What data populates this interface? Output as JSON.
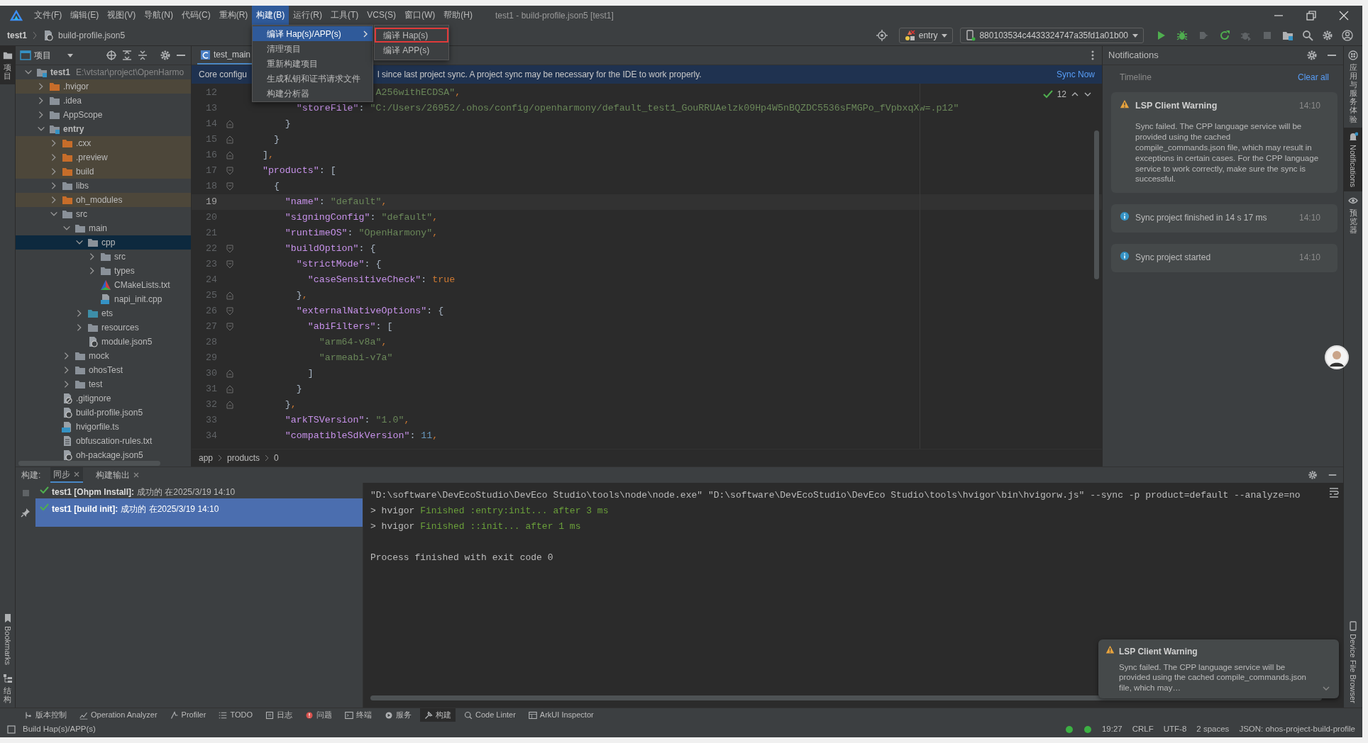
{
  "menubar": {
    "items": [
      {
        "label": "文件(F)",
        "selected": false
      },
      {
        "label": "编辑(E)",
        "selected": false
      },
      {
        "label": "视图(V)",
        "selected": false
      },
      {
        "label": "导航(N)",
        "selected": false
      },
      {
        "label": "代码(C)",
        "selected": false
      },
      {
        "label": "重构(R)",
        "selected": false
      },
      {
        "label": "构建(B)",
        "selected": true
      },
      {
        "label": "运行(R)",
        "selected": false
      },
      {
        "label": "工具(T)",
        "selected": false
      },
      {
        "label": "VCS(S)",
        "selected": false
      },
      {
        "label": "窗口(W)",
        "selected": false
      },
      {
        "label": "帮助(H)",
        "selected": false
      }
    ],
    "title": "test1 - build-profile.json5 [test1]"
  },
  "build_menu": {
    "items": [
      {
        "label": "编译 Hap(s)/APP(s)",
        "selected": true,
        "submenu": true
      },
      {
        "label": "清理项目",
        "selected": false,
        "submenu": false
      },
      {
        "label": "重新构建项目",
        "selected": false,
        "submenu": false
      },
      {
        "label": "生成私钥和证书请求文件",
        "selected": false,
        "submenu": false
      },
      {
        "label": "构建分析器",
        "selected": false,
        "submenu": false
      }
    ]
  },
  "submenu": {
    "items": [
      {
        "label": "编译 Hap(s)",
        "outlined": true
      },
      {
        "label": "编译 APP(s)",
        "outlined": false
      }
    ]
  },
  "navbar": {
    "project": "test1",
    "file": "build-profile.json5",
    "module": "entry",
    "device": "880103534c4433324747a35fd1a01b00"
  },
  "toolbar_buttons": [
    {
      "kind": "run",
      "disabled": false
    },
    {
      "kind": "debug",
      "disabled": false
    },
    {
      "kind": "profile",
      "disabled": true
    },
    {
      "kind": "restart",
      "disabled": false
    },
    {
      "kind": "attach",
      "disabled": true
    },
    {
      "kind": "stop",
      "disabled": true
    }
  ],
  "left_strip": {
    "top": [
      {
        "label": "项目",
        "selected": true
      }
    ],
    "bottom": [
      {
        "label": "Bookmarks",
        "kind": "latin"
      },
      {
        "label": "结构",
        "kind": "cjk"
      }
    ]
  },
  "project_panel": {
    "title": "项目",
    "tree": [
      {
        "name": "test1",
        "kind": "module",
        "path": "E:\\vtstar\\project\\OpenHarmo",
        "expanded": true,
        "selected": false,
        "children": [
          {
            "name": ".hvigor",
            "kind": "excluded",
            "expanded": false,
            "selected": false
          },
          {
            "name": ".idea",
            "kind": "folder",
            "expanded": false,
            "selected": false
          },
          {
            "name": "AppScope",
            "kind": "folder",
            "expanded": false,
            "selected": false
          },
          {
            "name": "entry",
            "kind": "module",
            "expanded": true,
            "selected": false,
            "children": [
              {
                "name": ".cxx",
                "kind": "excluded",
                "expanded": false,
                "selected": false
              },
              {
                "name": ".preview",
                "kind": "excluded",
                "expanded": false,
                "selected": false
              },
              {
                "name": "build",
                "kind": "excluded",
                "expanded": false,
                "selected": false
              },
              {
                "name": "libs",
                "kind": "folder",
                "expanded": false,
                "selected": false
              },
              {
                "name": "oh_modules",
                "kind": "excluded",
                "expanded": false,
                "selected": false
              },
              {
                "name": "src",
                "kind": "folder",
                "expanded": true,
                "selected": false,
                "children": [
                  {
                    "name": "main",
                    "kind": "folder",
                    "expanded": true,
                    "selected": false,
                    "children": [
                      {
                        "name": "cpp",
                        "kind": "folder",
                        "expanded": true,
                        "selected": true,
                        "children": [
                          {
                            "name": "src",
                            "kind": "folder",
                            "expanded": false,
                            "selected": false
                          },
                          {
                            "name": "types",
                            "kind": "folder",
                            "expanded": false,
                            "selected": false
                          },
                          {
                            "name": "CMakeLists.txt",
                            "kind": "cmake",
                            "selected": false
                          },
                          {
                            "name": "napi_init.cpp",
                            "kind": "cpp",
                            "selected": false
                          }
                        ]
                      },
                      {
                        "name": "ets",
                        "kind": "source",
                        "expanded": false,
                        "selected": false
                      },
                      {
                        "name": "resources",
                        "kind": "folder",
                        "expanded": false,
                        "selected": false
                      },
                      {
                        "name": "module.json5",
                        "kind": "json5",
                        "selected": false
                      }
                    ]
                  },
                  {
                    "name": "mock",
                    "kind": "folder",
                    "expanded": false,
                    "selected": false
                  },
                  {
                    "name": "ohosTest",
                    "kind": "folder",
                    "expanded": false,
                    "selected": false
                  },
                  {
                    "name": "test",
                    "kind": "folder",
                    "expanded": false,
                    "selected": false
                  }
                ]
              },
              {
                "name": ".gitignore",
                "kind": "gitignore",
                "selected": false
              },
              {
                "name": "build-profile.json5",
                "kind": "json5",
                "selected": false
              },
              {
                "name": "hvigorfile.ts",
                "kind": "ts",
                "selected": false
              },
              {
                "name": "obfuscation-rules.txt",
                "kind": "text",
                "selected": false
              },
              {
                "name": "oh-package.json5",
                "kind": "json5",
                "selected": false
              }
            ]
          }
        ]
      }
    ]
  },
  "editor": {
    "tab": "test_main",
    "banner": {
      "text_start": "Core configu",
      "text_end": "l since last project sync. A project sync may be necessary for the IDE to work properly.",
      "action": "Sync Now"
    },
    "inspections": "12",
    "lines": [
      {
        "number": "12",
        "current": false,
        "partial": true,
        "tokens": [
          {
            "kind": "str",
            "s": "A256withECDSA\""
          },
          {
            "kind": "c",
            "s": ","
          }
        ]
      },
      {
        "number": "13",
        "current": false,
        "tokens": [
          {
            "kind": "key",
            "s": "\"storeFile\""
          },
          {
            "kind": "p",
            "s": ": "
          },
          {
            "kind": "str",
            "s": "\"C:/Users/26952/.ohos/config/openharmony/default_test1_GouRRUAelzk09Hp4W5nBQZDC5536sFMGPo_fVpbxqXw=.p12\""
          }
        ]
      },
      {
        "number": "14",
        "current": false,
        "fold_end": true,
        "tokens": [
          {
            "kind": "p",
            "s": "}"
          }
        ]
      },
      {
        "number": "15",
        "current": false,
        "fold_end": true,
        "tokens": [
          {
            "kind": "p",
            "s": "}"
          }
        ]
      },
      {
        "number": "16",
        "current": false,
        "fold_end": true,
        "tokens": [
          {
            "kind": "p",
            "s": "]"
          },
          {
            "kind": "c",
            "s": ","
          }
        ]
      },
      {
        "number": "17",
        "current": false,
        "fold_start": true,
        "tokens": [
          {
            "kind": "key",
            "s": "\"products\""
          },
          {
            "kind": "p",
            "s": ": ["
          }
        ]
      },
      {
        "number": "18",
        "current": false,
        "fold_start": true,
        "tokens": [
          {
            "kind": "p",
            "s": "{"
          }
        ]
      },
      {
        "number": "19",
        "current": true,
        "tokens": [
          {
            "kind": "key",
            "s": "\"name\""
          },
          {
            "kind": "p",
            "s": ": "
          },
          {
            "kind": "str",
            "s": "\"default\""
          },
          {
            "kind": "c",
            "s": ","
          }
        ]
      },
      {
        "number": "20",
        "current": false,
        "tokens": [
          {
            "kind": "key",
            "s": "\"signingConfig\""
          },
          {
            "kind": "p",
            "s": ": "
          },
          {
            "kind": "str",
            "s": "\"default\""
          },
          {
            "kind": "c",
            "s": ","
          }
        ]
      },
      {
        "number": "21",
        "current": false,
        "tokens": [
          {
            "kind": "key",
            "s": "\"runtimeOS\""
          },
          {
            "kind": "p",
            "s": ": "
          },
          {
            "kind": "str",
            "s": "\"OpenHarmony\""
          },
          {
            "kind": "c",
            "s": ","
          }
        ]
      },
      {
        "number": "22",
        "current": false,
        "fold_start": true,
        "tokens": [
          {
            "kind": "key",
            "s": "\"buildOption\""
          },
          {
            "kind": "p",
            "s": ": {"
          }
        ]
      },
      {
        "number": "23",
        "current": false,
        "fold_start": true,
        "tokens": [
          {
            "kind": "key",
            "s": "\"strictMode\""
          },
          {
            "kind": "p",
            "s": ": {"
          }
        ]
      },
      {
        "number": "24",
        "current": false,
        "tokens": [
          {
            "kind": "key",
            "s": "\"caseSensitiveCheck\""
          },
          {
            "kind": "p",
            "s": ": "
          },
          {
            "kind": "bool",
            "s": "true"
          }
        ]
      },
      {
        "number": "25",
        "current": false,
        "fold_end": true,
        "tokens": [
          {
            "kind": "p",
            "s": "}"
          },
          {
            "kind": "c",
            "s": ","
          }
        ]
      },
      {
        "number": "26",
        "current": false,
        "fold_start": true,
        "tokens": [
          {
            "kind": "key",
            "s": "\"externalNativeOptions\""
          },
          {
            "kind": "p",
            "s": ": {"
          }
        ]
      },
      {
        "number": "27",
        "current": false,
        "fold_start": true,
        "tokens": [
          {
            "kind": "key",
            "s": "\"abiFilters\""
          },
          {
            "kind": "p",
            "s": ": ["
          }
        ]
      },
      {
        "number": "28",
        "current": false,
        "tokens": [
          {
            "kind": "str",
            "s": "\"arm64-v8a\""
          },
          {
            "kind": "c",
            "s": ","
          }
        ]
      },
      {
        "number": "29",
        "current": false,
        "tokens": [
          {
            "kind": "str",
            "s": "\"armeabi-v7a\""
          }
        ]
      },
      {
        "number": "30",
        "current": false,
        "fold_end": true,
        "tokens": [
          {
            "kind": "p",
            "s": "]"
          }
        ]
      },
      {
        "number": "31",
        "current": false,
        "fold_end": true,
        "tokens": [
          {
            "kind": "p",
            "s": "}"
          }
        ]
      },
      {
        "number": "32",
        "current": false,
        "fold_end": true,
        "tokens": [
          {
            "kind": "p",
            "s": "}"
          },
          {
            "kind": "c",
            "s": ","
          }
        ]
      },
      {
        "number": "33",
        "current": false,
        "tokens": [
          {
            "kind": "key",
            "s": "\"arkTSVersion\""
          },
          {
            "kind": "p",
            "s": ": "
          },
          {
            "kind": "str",
            "s": "\"1.0\""
          },
          {
            "kind": "c",
            "s": ","
          }
        ]
      },
      {
        "number": "34",
        "current": false,
        "tokens": [
          {
            "kind": "key",
            "s": "\"compatibleSdkVersion\""
          },
          {
            "kind": "p",
            "s": ": "
          },
          {
            "kind": "num",
            "s": "11"
          },
          {
            "kind": "c",
            "s": ","
          }
        ]
      }
    ],
    "breadcrumb": [
      "app",
      "products",
      "0"
    ]
  },
  "notifications": {
    "title": "Notifications",
    "timeline": "Timeline",
    "clear": "Clear all",
    "items": [
      {
        "kind": "warning",
        "title": "LSP Client Warning",
        "body": "Sync failed. The CPP language service will be provided using the cached compile_commands.json file, which may result in exceptions in certain cases. For the CPP language service to work correctly, make sure the sync is successful.",
        "time": "14:10"
      },
      {
        "kind": "info",
        "title": "Sync project finished in 14 s 17 ms",
        "time": "14:10"
      },
      {
        "kind": "info",
        "title": "Sync project started",
        "time": "14:10"
      }
    ]
  },
  "right_strip": {
    "top": [
      {
        "label": "应用与服务体验",
        "kind": "cjk",
        "selected": false
      },
      {
        "label": "Notifications",
        "kind": "latin",
        "selected": true
      },
      {
        "label": "预览器",
        "kind": "cjk",
        "selected": false
      }
    ],
    "bottom": [
      {
        "label": "Device File Browser",
        "kind": "latin"
      }
    ]
  },
  "build_panel": {
    "label": "构建:",
    "tabs": [
      {
        "label": "同步",
        "selected": true
      },
      {
        "label": "构建输出",
        "selected": false
      }
    ],
    "tasks": [
      {
        "name": "test1 [Ohpm Install]:",
        "status": "成功的 在2025/3/19 14:10",
        "selected": false
      },
      {
        "name": "test1 [build init]:",
        "status": "成功的 在2025/3/19 14:10",
        "selected": true
      }
    ],
    "console": [
      {
        "kind": "command",
        "text": "\"D:\\software\\DevEcoStudio\\DevEco Studio\\tools\\node\\node.exe\" \"D:\\software\\DevEcoStudio\\DevEco Studio\\tools\\hvigor\\bin\\hvigorw.js\" --sync -p product=default --analyze=no"
      },
      {
        "kind": "log",
        "prefix": "> hvigor",
        "text": "Finished :entry:init... after 3 ms"
      },
      {
        "kind": "log",
        "prefix": "> hvigor",
        "text": "Finished ::init... after 1 ms"
      },
      {
        "kind": "exit",
        "text": "Process finished with exit code 0"
      }
    ]
  },
  "toast": {
    "title": "LSP Client Warning",
    "body": "Sync failed. The CPP language service will be provided using the cached compile_commands.json file, which may…"
  },
  "tool_windows": [
    {
      "label": "版本控制",
      "kind": "vcs",
      "selected": false
    },
    {
      "label": "Operation Analyzer",
      "kind": "analyzer",
      "selected": false
    },
    {
      "label": "Profiler",
      "kind": "profiler",
      "selected": false
    },
    {
      "label": "TODO",
      "kind": "todo",
      "selected": false
    },
    {
      "label": "日志",
      "kind": "log",
      "selected": false
    },
    {
      "label": "问题",
      "kind": "problems",
      "selected": false
    },
    {
      "label": "终端",
      "kind": "terminal",
      "selected": false
    },
    {
      "label": "服务",
      "kind": "services",
      "selected": false
    },
    {
      "label": "构建",
      "kind": "build",
      "selected": true
    },
    {
      "label": "Code Linter",
      "kind": "linter",
      "selected": false
    },
    {
      "label": "ArkUI Inspector",
      "kind": "inspector",
      "selected": false
    }
  ],
  "status_bar": {
    "task": "Build Hap(s)/APP(s)",
    "items": [
      "19:27",
      "CRLF",
      "UTF-8",
      "2 spaces",
      "JSON: ohos-project-build-profile"
    ]
  }
}
